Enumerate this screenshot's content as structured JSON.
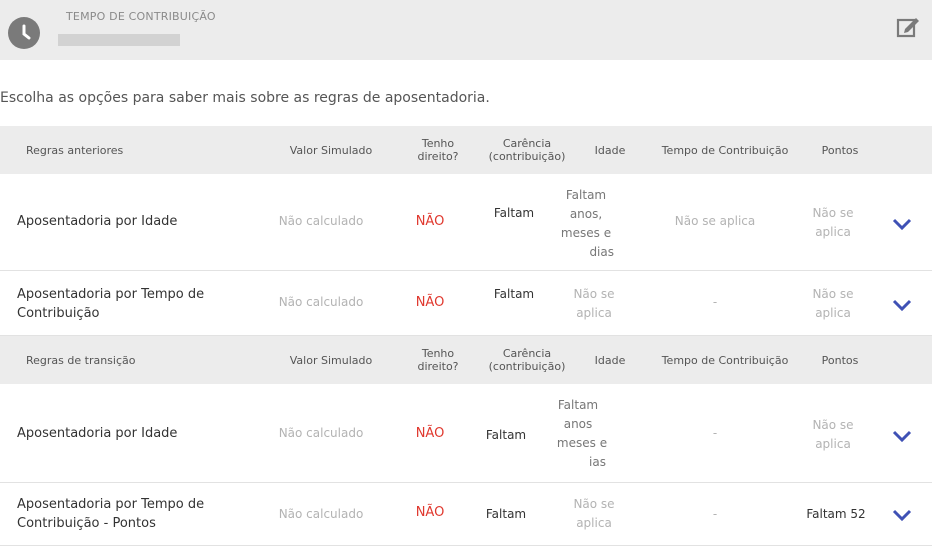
{
  "header": {
    "title": "TEMPO DE CONTRIBUIÇÃO",
    "clock_icon": "clock-icon",
    "edit_icon": "edit-icon"
  },
  "intro": "Escolha as opções para saber mais sobre as regras de aposentadoria.",
  "columns": {
    "valor": "Valor Simulado",
    "direito_l1": "Tenho",
    "direito_l2": "direito?",
    "carencia_l1": "Carência",
    "carencia_l2": "(contribuição)",
    "idade": "Idade",
    "tempo": "Tempo de Contribuição",
    "pontos": "Pontos"
  },
  "sections": [
    {
      "title": "Regras anteriores",
      "rows": [
        {
          "name_l1": "Aposentadoria por Idade",
          "name_l2": "",
          "valor": "Não calculado",
          "direito": "NÃO",
          "carencia": "Faltam",
          "idade": [
            "Faltam",
            "anos,",
            "meses e",
            "dias"
          ],
          "tempo": "Não se aplica",
          "pontos": [
            "Não se",
            "aplica"
          ]
        },
        {
          "name_l1": "Aposentadoria por Tempo de",
          "name_l2": "Contribuição",
          "valor": "Não calculado",
          "direito": "NÃO",
          "carencia": "Faltam",
          "idade": [
            "Não se",
            "aplica"
          ],
          "tempo": "-",
          "pontos": [
            "Não se",
            "aplica"
          ]
        }
      ]
    },
    {
      "title": "Regras de transição",
      "rows": [
        {
          "name_l1": "Aposentadoria por Idade",
          "name_l2": "",
          "valor": "Não calculado",
          "direito": "NÃO",
          "carencia": "Faltam",
          "idade": [
            "Faltam",
            "anos",
            "meses e",
            "ias"
          ],
          "tempo": "-",
          "pontos": [
            "Não se",
            "aplica"
          ]
        },
        {
          "name_l1": "Aposentadoria por Tempo de",
          "name_l2": "Contribuição - Pontos",
          "valor": "Não calculado",
          "direito": "NÃO",
          "carencia": "Faltam",
          "idade": [
            "Não se",
            "aplica"
          ],
          "tempo": "-",
          "pontos": [
            "Faltam 52"
          ]
        }
      ]
    }
  ],
  "colors": {
    "red": "#e0382e",
    "chevron": "#3f51b5",
    "header_bg": "#ececec"
  }
}
